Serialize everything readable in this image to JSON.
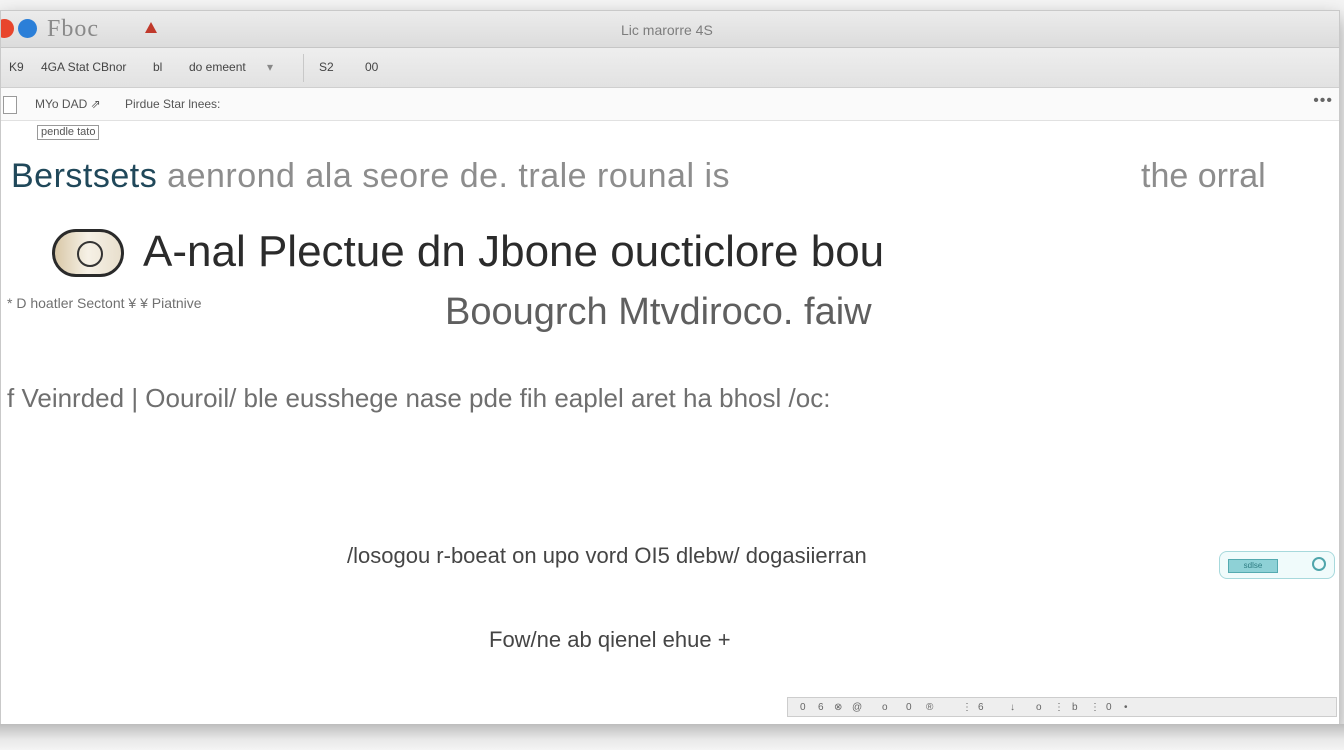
{
  "window": {
    "app_name": "Fboc",
    "title": "Lic marorre 4S"
  },
  "toolbar": {
    "back": "K9",
    "item1": "4GA Stat CBnor",
    "item2": "bl",
    "item3": "do emeent",
    "item3_caret": "▾",
    "item4": "S2",
    "item5": "00"
  },
  "address": {
    "text1": "MYo DAD ⇗",
    "text2": "Pirdue Star lnees:",
    "menu": "•••"
  },
  "content": {
    "tag": "pendle tato",
    "headline_dark": "Berstsets",
    "headline_rest": "aenrond ala seore de. trale  rounal is",
    "headline_right": "the orral",
    "hero_title": "A-nal Plectue dn Jbone oucticlore bou",
    "section_label": "* D hoatler Sectont ¥ ¥ Piatnive",
    "sub_title": "Boougrch Mtvdiroco. faiw",
    "body_line": "f Veinrded | Oouroil/ ble eusshege nase pde fih eaplel aret ha bhosl /oc:",
    "mid_line": "/losogou r-boeat on  upo vord OI5 dlebw/ dogasiierran",
    "follow_line": "Fow/ne ab qienel ehue +",
    "pill_label": "sdlse"
  },
  "status": {
    "icons": [
      "0",
      "6",
      "⊗",
      "@",
      "o",
      "0",
      "®",
      "⋮",
      "6",
      "↓",
      "o",
      "⋮",
      "b",
      "⋮",
      "0",
      "•"
    ]
  },
  "colors": {
    "accent_dark": "#20485a",
    "close": "#e8452c",
    "blue": "#2b7fd8",
    "warn": "#c0392b",
    "pill_border": "#a7d9dc"
  }
}
